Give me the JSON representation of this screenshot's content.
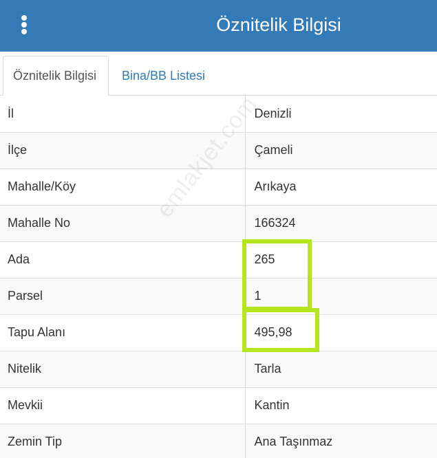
{
  "header": {
    "title": "Öznitelik Bilgisi",
    "menu_icon": "more-vertical-icon"
  },
  "tabs": [
    {
      "label": "Öznitelik Bilgisi",
      "active": true
    },
    {
      "label": "Bina/BB Listesi",
      "active": false
    }
  ],
  "attributes": [
    {
      "key": "İl",
      "value": "Denizli"
    },
    {
      "key": "İlçe",
      "value": "Çameli"
    },
    {
      "key": "Mahalle/Köy",
      "value": "Arıkaya"
    },
    {
      "key": "Mahalle No",
      "value": "166324"
    },
    {
      "key": "Ada",
      "value": "265"
    },
    {
      "key": "Parsel",
      "value": "1"
    },
    {
      "key": "Tapu Alanı",
      "value": "495,98"
    },
    {
      "key": "Nitelik",
      "value": "Tarla"
    },
    {
      "key": "Mevkii",
      "value": "Kantin"
    },
    {
      "key": "Zemin Tip",
      "value": "Ana Taşınmaz"
    }
  ],
  "watermark": "emlakjet.com",
  "colors": {
    "header_bg": "#337ab7",
    "tab_link": "#337ab7",
    "highlight": "#b5e61d"
  }
}
